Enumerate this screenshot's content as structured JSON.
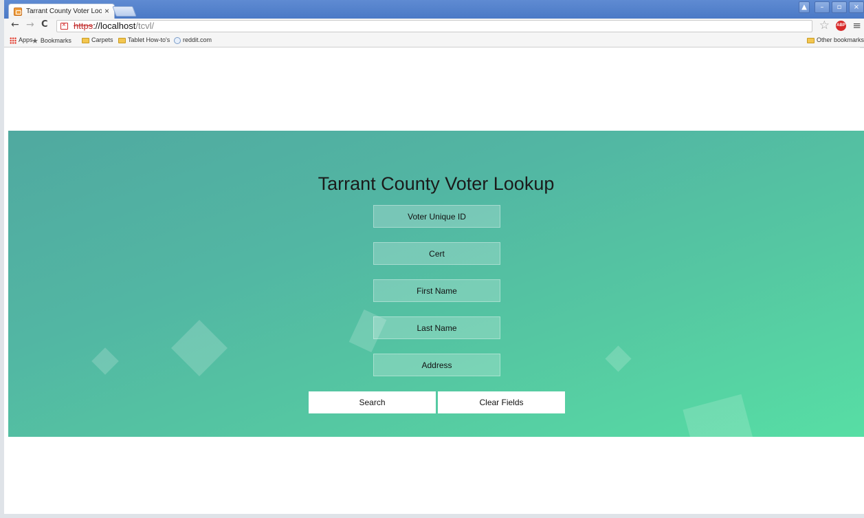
{
  "browser": {
    "tab_title": "Tarrant County Voter Looku",
    "tab_close": "×",
    "url_scheme": "https",
    "url_host": "://localhost",
    "url_path": "/tcvl/",
    "abp_label": "ABP",
    "window_controls": [
      "▲",
      "–",
      "▫",
      "×"
    ],
    "bookmarks": [
      {
        "label": "Apps",
        "icon": "apps-icon"
      },
      {
        "label": "Bookmarks",
        "icon": "star-icon"
      },
      {
        "label": "Carpets",
        "icon": "folder-icon"
      },
      {
        "label": "Tablet How-to's",
        "icon": "folder-icon"
      },
      {
        "label": "reddit.com",
        "icon": "globe-icon"
      }
    ],
    "other_bookmarks": "Other bookmarks"
  },
  "page": {
    "title": "Tarrant County Voter Lookup",
    "fields": [
      {
        "placeholder": "Voter Unique ID",
        "value": ""
      },
      {
        "placeholder": "Cert",
        "value": ""
      },
      {
        "placeholder": "First Name",
        "value": ""
      },
      {
        "placeholder": "Last Name",
        "value": ""
      },
      {
        "placeholder": "Address",
        "value": ""
      }
    ],
    "search_button": "Search",
    "clear_button": "Clear Fields"
  },
  "colors": {
    "hero_gradient_start": "#50a9a0",
    "hero_gradient_end": "#57dea4",
    "button_bg": "#ffffff",
    "titlebar": "#4a79c6"
  }
}
